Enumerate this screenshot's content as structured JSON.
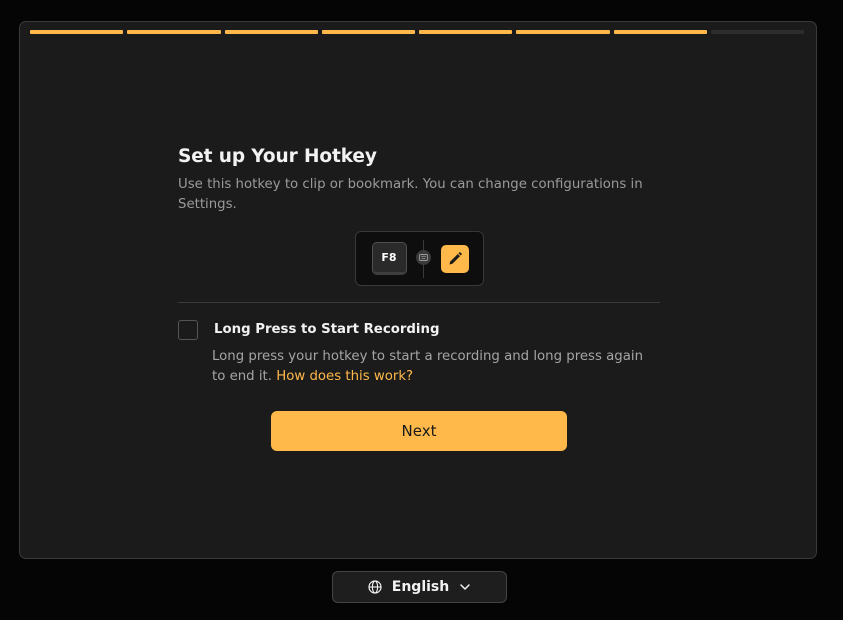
{
  "progress": {
    "total_steps": 8,
    "completed_steps": 7
  },
  "colors": {
    "accent": "#ffb94a",
    "panel": "#1b1b1b",
    "background": "#050505"
  },
  "hotkey_setup": {
    "title": "Set up Your Hotkey",
    "subtitle": "Use this hotkey to clip or bookmark. You can change configurations in Settings.",
    "hotkey_key": "F8",
    "hotkey_type_icon": "keyboard-icon",
    "edit_icon": "pencil-icon"
  },
  "long_press_option": {
    "checked": false,
    "label": "Long Press to Start Recording",
    "description": "Long press your hotkey to start a recording and long press again to end it.",
    "link_text": "How does this work?"
  },
  "next_button": {
    "label": "Next"
  },
  "language": {
    "icon": "globe-icon",
    "selected": "English",
    "dropdown_icon": "chevron-down-icon"
  }
}
